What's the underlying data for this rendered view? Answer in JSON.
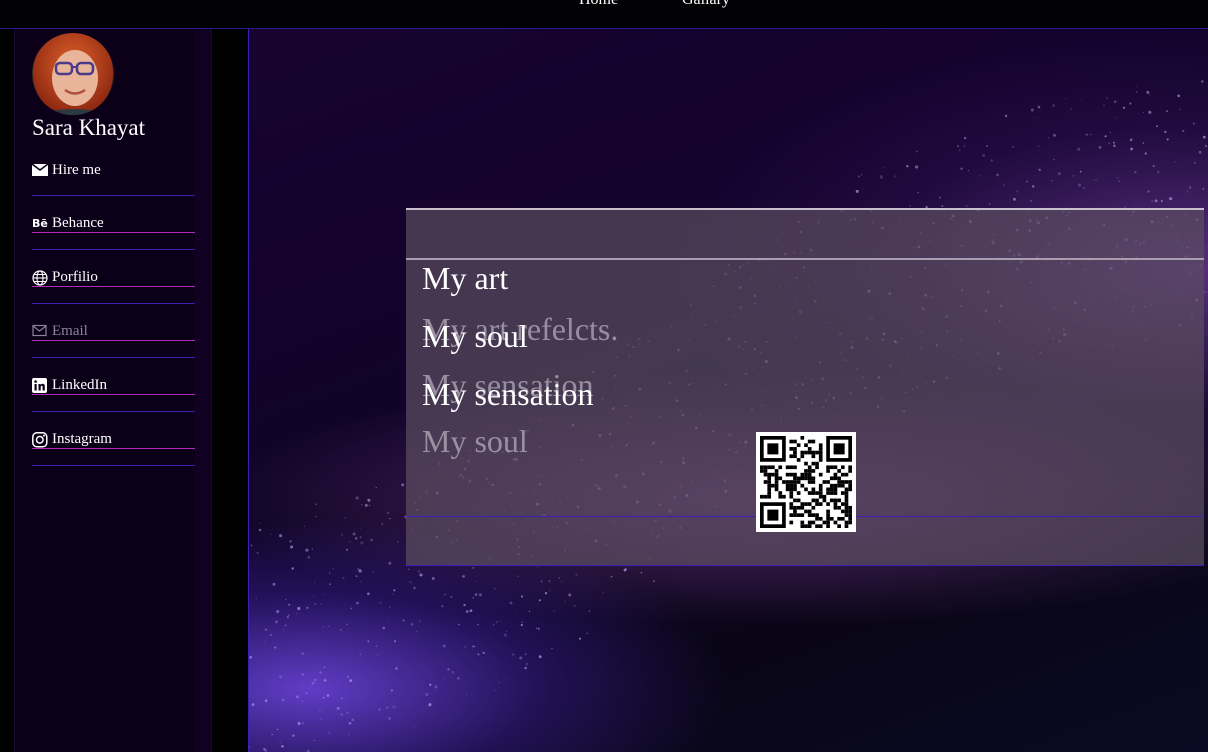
{
  "topnav": {
    "items": [
      {
        "label": "Home"
      },
      {
        "label": "Gallary"
      }
    ]
  },
  "profile": {
    "name": "Sara Khayat"
  },
  "sidebar": {
    "items": [
      {
        "label": "Hire me",
        "icon": "envelope-icon"
      },
      {
        "label": "Behance",
        "icon": "behance-icon"
      },
      {
        "label": "Porfilio",
        "icon": "globe-icon"
      },
      {
        "label": "",
        "placeholder": "Email",
        "icon": "mail-outline-icon"
      },
      {
        "label": "LinkedIn",
        "icon": "linkedin-icon"
      },
      {
        "label": "Instagram",
        "icon": "instagram-icon"
      }
    ]
  },
  "slider": {
    "front_lines": [
      "My art",
      "My soul",
      "My sensation"
    ],
    "ghost_lines": [
      "My art refelcts.",
      "My sensation",
      "My soul"
    ]
  },
  "colors": {
    "accent_purple": "#3a1fb8",
    "underline_magenta": "#b22ab8",
    "panel_overlay": "#5a4c5f"
  }
}
